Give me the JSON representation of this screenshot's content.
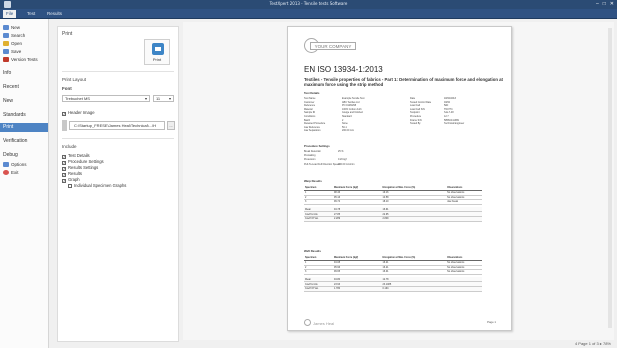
{
  "window": {
    "title": "TestXpert 2013 - Tensile tests Software"
  },
  "menubar": {
    "tabs": [
      "File",
      "Test",
      "Results"
    ],
    "active_index": 0
  },
  "sidebar": {
    "commands": [
      {
        "label": "New",
        "icon": "new-icon",
        "color": "#5b8ad0"
      },
      {
        "label": "Search",
        "icon": "search-icon",
        "color": "#5b8ad0"
      },
      {
        "label": "Open",
        "icon": "open-icon",
        "color": "#e0b030"
      },
      {
        "label": "Save",
        "icon": "save-icon",
        "color": "#5b8ad0"
      },
      {
        "label": "Version Tests",
        "icon": "version-icon",
        "color": "#c0392b"
      }
    ],
    "sections": [
      "Info",
      "Recent",
      "New",
      "Standards",
      "Print",
      "Verification",
      "Debug"
    ],
    "active_section": "Print",
    "bottom": [
      {
        "label": "Options",
        "icon": "options-icon",
        "color": "#5b8ad0"
      },
      {
        "label": "Exit",
        "icon": "exit-icon",
        "color": "#d9534f"
      }
    ]
  },
  "print_panel": {
    "heading": "Print",
    "print_button": "Print",
    "layout_heading": "Print Layout",
    "font_label": "Font",
    "font_value": "Trebuchet MS",
    "font_size": "11",
    "header_image_label": "Header Image",
    "header_image_path": "C:\\Startup_FRESE\\James Heal\\Technical\\...\\H",
    "browse_label": "...",
    "include_heading": "Include",
    "includes": [
      {
        "label": "Test Details",
        "checked": true
      },
      {
        "label": "Procedure Settings",
        "checked": true
      },
      {
        "label": "Results Settings",
        "checked": true
      },
      {
        "label": "Results",
        "checked": true
      },
      {
        "label": "Graph",
        "checked": true
      },
      {
        "label": "Individual Specimen Graphs",
        "checked": false
      }
    ]
  },
  "report": {
    "logo_text": "YOUR COMPANY",
    "standard": "EN ISO 13934-1:2013",
    "subtitle": "Textiles - Tensile properties of fabrics - Part 1: Determination of maximum force and elongation at maximum force using the strip method",
    "test_details_heading": "Test Details",
    "test_details_left": [
      [
        "Test Name",
        "Example Tensile Test"
      ],
      [
        "Customer",
        "ABC Textiles Ltd"
      ],
      [
        "Reference",
        "PO 01284/98"
      ],
      [
        "Material",
        "100% Cotton cloth"
      ],
      [
        "Sample ID",
        "Greige and finished"
      ],
      [
        "Conditions",
        "Standard"
      ],
      [
        "Batch",
        "2"
      ],
      [
        "Retested Procedure",
        "None"
      ],
      [
        "Jaw Reference",
        "50-1"
      ],
      [
        "Jaw Separation",
        "200.00 mm"
      ]
    ],
    "test_details_right": [
      [
        "Date",
        "18/02/2013"
      ],
      [
        "Tested Control Date",
        "03/02"
      ],
      [
        "Load Cell",
        "5kN"
      ],
      [
        "Load Cell S/N",
        "TN4774"
      ],
      [
        "Testpoint",
        "S-E-7-48"
      ],
      [
        "Procedure",
        "12.7"
      ],
      [
        "Frame S/N",
        "5856C411389"
      ],
      [
        "Tested By",
        "Technical Engineer"
      ]
    ],
    "procedure_heading": "Procedure Settings",
    "procedure": [
      [
        "Break Detection",
        "25 %"
      ],
      [
        "Preloading",
        ""
      ],
      [
        "Pretension",
        "0.20 kgf"
      ],
      [
        "Pull-To-Load Full Direction Speed",
        "100.00 mm/min"
      ]
    ],
    "warp_heading": "Warp Results",
    "weft_heading": "Weft Results",
    "table_headers": [
      "Specimen",
      "Maximum Force (kgf)",
      "Elongation at Max. Force (%)",
      "Observations"
    ],
    "warp_rows": [
      [
        "1",
        "98.46",
        "19.16",
        "No observations"
      ],
      [
        "2",
        "95.16",
        "10.58",
        "No observations"
      ],
      [
        "3",
        "99.74",
        "18.10",
        "Jaw break"
      ]
    ],
    "warp_stats": [
      [
        "Mean",
        "94.78",
        "16.91",
        ""
      ],
      [
        "Coeff Limits",
        "27.85",
        "22.95",
        ""
      ],
      [
        "Coeff Of Var.",
        "2.289",
        "2.809",
        ""
      ]
    ],
    "weft_rows": [
      [
        "1",
        "94.08",
        "16.21",
        "No observations"
      ],
      [
        "2",
        "95.96",
        "16.21",
        "No observations"
      ],
      [
        "3",
        "99.65",
        "16.01",
        "No observations"
      ]
    ],
    "weft_stats": [
      [
        "Mean",
        "94.80",
        "12.78",
        ""
      ],
      [
        "Coeff Limits",
        "23.93",
        "23.1085",
        ""
      ],
      [
        "Coeff Of Var.",
        "1.780",
        "0.194",
        ""
      ]
    ],
    "footer_brand": "James Heal",
    "page_footer": "Page 1"
  },
  "status": {
    "page_indicator": "4 Page 1 of 3  ▸",
    "zoom": "78%"
  }
}
